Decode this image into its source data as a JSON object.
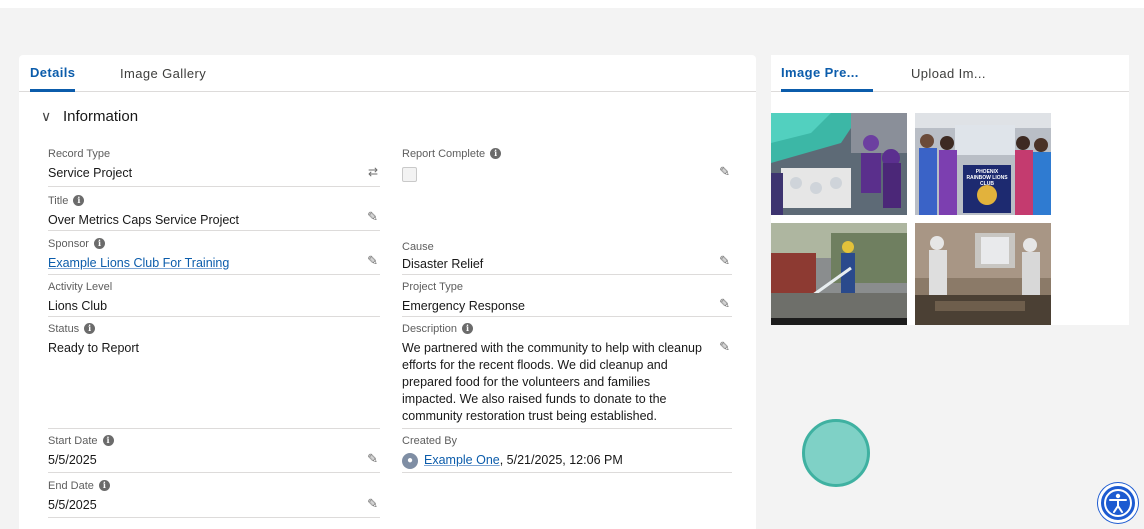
{
  "tabs_left": [
    "Details",
    "Image Gallery"
  ],
  "tabs_right": [
    "Image Pre...",
    "Upload Im..."
  ],
  "section_title": "Information",
  "fields": {
    "record_type": {
      "label": "Record Type",
      "value": "Service Project"
    },
    "report_complete": {
      "label": "Report Complete"
    },
    "title": {
      "label": "Title",
      "value": "Over Metrics Caps Service Project"
    },
    "sponsor": {
      "label": "Sponsor",
      "value": "Example Lions Club For Training"
    },
    "cause": {
      "label": "Cause",
      "value": "Disaster Relief"
    },
    "activity_level": {
      "label": "Activity Level",
      "value": "Lions Club"
    },
    "project_type": {
      "label": "Project Type",
      "value": "Emergency Response"
    },
    "status": {
      "label": "Status",
      "value": "Ready to Report"
    },
    "description": {
      "label": "Description",
      "value": "We partnered with the community to help with cleanup efforts for the recent floods. We did cleanup and prepared food for the volunteers and families impacted. We also raised funds to donate to the community restoration trust being established."
    },
    "start_date": {
      "label": "Start Date",
      "value": "5/5/2025"
    },
    "created_by": {
      "label": "Created By",
      "user": "Example One",
      "stamp": ", 5/21/2025, 12:06 PM"
    },
    "end_date": {
      "label": "End Date",
      "value": "5/5/2025"
    }
  },
  "banner_text": "PHOENIX RAINBOW LIONS CLUB",
  "icons": {
    "info": "i",
    "pencil": "✎",
    "chevron": "∨"
  },
  "colors": {
    "accent": "#0b5cab",
    "teal": "#7fd1c6",
    "a11y": "#1d5bd1"
  }
}
